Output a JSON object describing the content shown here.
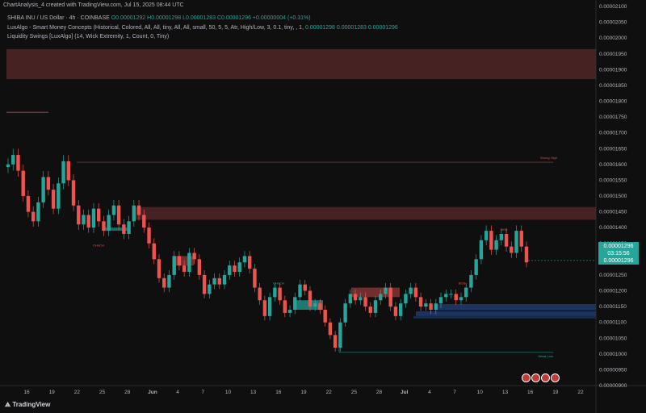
{
  "header": {
    "top_line": "ChartAnalysis_4 created with TradingView.com, Jul 15, 2025 08:44 UTC",
    "symbol": "SHIBA INU / US Dollar · 4h · COINBASE",
    "ohlc": "O0.00001292 H0.00001298 L0.00001283 C0.00001296 +0.00000004 (+0.31%)",
    "smc_indicator": "LuxAlgo - Smart Money Concepts (Historical, Colored, All, All, tiny, All, All, small, 50, 5, 5, Atr, High/Low, 3, 0.1, tiny, , 1,",
    "smc_values": "0.00001298  0.00001283  0.00001296",
    "liq_indicator": "Liquidity Swings [LuxAlgo] (14, Wick Extremity, 1, Count, 0, Tiny)"
  },
  "price_tag": {
    "price": "0.00001296",
    "countdown": "03:15:56",
    "price2": "0.00001296"
  },
  "footer": {
    "brand": "TradingView"
  },
  "colors": {
    "up": "#26a69a",
    "down": "#ef5350",
    "zone_red": "#5a2a2a",
    "zone_blue": "#1f3a6b"
  },
  "chart_data": {
    "type": "candlestick",
    "title": "SHIBA INU / US Dollar · 4h · COINBASE",
    "y_ticks": [
      "0.00002100",
      "0.00002050",
      "0.00002000",
      "0.00001950",
      "0.00001900",
      "0.00001850",
      "0.00001800",
      "0.00001750",
      "0.00001700",
      "0.00001650",
      "0.00001600",
      "0.00001550",
      "0.00001500",
      "0.00001450",
      "0.00001400",
      "0.00001350",
      "0.00001300",
      "0.00001250",
      "0.00001200",
      "0.00001150",
      "0.00001100",
      "0.00001050",
      "0.00001000",
      "0.00000950",
      "0.00000900"
    ],
    "x_ticks": [
      "16",
      "19",
      "22",
      "25",
      "28",
      "Jun",
      "4",
      "7",
      "10",
      "13",
      "16",
      "19",
      "22",
      "25",
      "28",
      "Jul",
      "4",
      "7",
      "10",
      "13",
      "16",
      "19",
      "22"
    ],
    "ylim": [
      9e-06,
      2.1e-05
    ],
    "annotations": [
      "Strong High",
      "Weak Low",
      "CHoCH",
      "BOS",
      "CHoCH",
      "BOS"
    ],
    "path_close": [
      1.6e-05,
      1.63e-05,
      1.58e-05,
      1.5e-05,
      1.45e-05,
      1.42e-05,
      1.48e-05,
      1.56e-05,
      1.52e-05,
      1.46e-05,
      1.54e-05,
      1.61e-05,
      1.55e-05,
      1.47e-05,
      1.41e-05,
      1.44e-05,
      1.4e-05,
      1.46e-05,
      1.42e-05,
      1.39e-05,
      1.44e-05,
      1.47e-05,
      1.41e-05,
      1.38e-05,
      1.42e-05,
      1.47e-05,
      1.44e-05,
      1.4e-05,
      1.35e-05,
      1.3e-05,
      1.24e-05,
      1.21e-05,
      1.25e-05,
      1.31e-05,
      1.28e-05,
      1.26e-05,
      1.32e-05,
      1.3e-05,
      1.25e-05,
      1.19e-05,
      1.22e-05,
      1.24e-05,
      1.22e-05,
      1.25e-05,
      1.28e-05,
      1.26e-05,
      1.29e-05,
      1.31e-05,
      1.27e-05,
      1.21e-05,
      1.17e-05,
      1.12e-05,
      1.18e-05,
      1.21e-05,
      1.17e-05,
      1.13e-05,
      1.14e-05,
      1.18e-05,
      1.22e-05,
      1.2e-05,
      1.15e-05,
      1.16e-05,
      1.14e-05,
      1.1e-05,
      1.06e-05,
      1.02e-05,
      1.1e-05,
      1.16e-05,
      1.19e-05,
      1.17e-05,
      1.18e-05,
      1.15e-05,
      1.13e-05,
      1.17e-05,
      1.19e-05,
      1.21e-05,
      1.15e-05,
      1.12e-05,
      1.16e-05,
      1.19e-05,
      1.21e-05,
      1.18e-05,
      1.15e-05,
      1.16e-05,
      1.14e-05,
      1.16e-05,
      1.18e-05,
      1.19e-05,
      1.19e-05,
      1.17e-05,
      1.18e-05,
      1.21e-05,
      1.25e-05,
      1.3e-05,
      1.36e-05,
      1.39e-05,
      1.33e-05,
      1.36e-05,
      1.38e-05,
      1.34e-05,
      1.32e-05,
      1.39e-05,
      1.34e-05,
      1.29e-05
    ]
  }
}
